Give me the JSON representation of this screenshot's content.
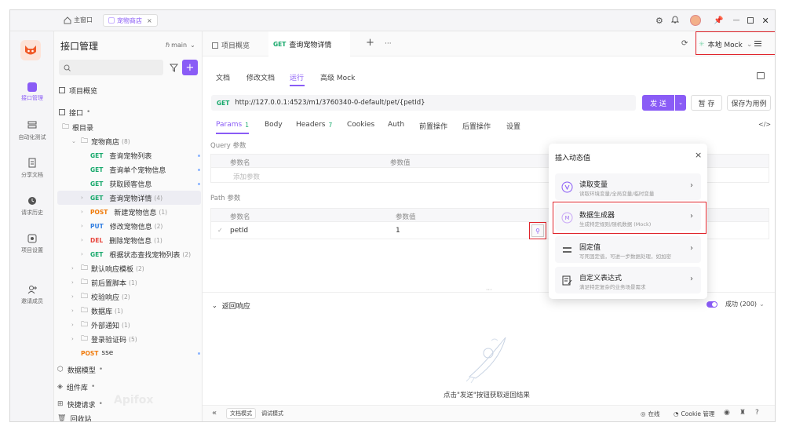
{
  "window": {
    "home_tab": "主窗口",
    "project_tab": "宠物商店"
  },
  "left_nav": [
    {
      "label": "接口管理",
      "icon": "api-management-icon"
    },
    {
      "label": "自动化测试",
      "icon": "automation-icon"
    },
    {
      "label": "分享文档",
      "icon": "share-docs-icon"
    },
    {
      "label": "请求历史",
      "icon": "history-icon"
    },
    {
      "label": "项目设置",
      "icon": "settings-icon"
    },
    {
      "label": "邀请成员",
      "icon": "invite-icon"
    }
  ],
  "tree": {
    "title": "接口管理",
    "branch": "main",
    "search_placeholder": "",
    "overview": "项目概览",
    "interfaces": "接口",
    "root": "根目录",
    "folder": "宠物商店",
    "folder_count": "(8)",
    "endpoints": [
      {
        "method": "GET",
        "name": "查询宠物列表",
        "count": ""
      },
      {
        "method": "GET",
        "name": "查询单个宠物信息",
        "count": ""
      },
      {
        "method": "GET",
        "name": "获取顾客信息",
        "count": ""
      },
      {
        "method": "GET",
        "name": "查询宠物详情",
        "count": "(4)"
      },
      {
        "method": "POST",
        "name": "新建宠物信息",
        "count": "(1)"
      },
      {
        "method": "PUT",
        "name": "修改宠物信息",
        "count": "(2)"
      },
      {
        "method": "DEL",
        "name": "删除宠物信息",
        "count": "(1)"
      },
      {
        "method": "GET",
        "name": "根据状态查找宠物列表",
        "count": "(2)"
      }
    ],
    "folders": [
      {
        "name": "默认响应模板",
        "count": "(2)"
      },
      {
        "name": "前后置脚本",
        "count": "(1)"
      },
      {
        "name": "校验响应",
        "count": "(2)"
      },
      {
        "name": "数据库",
        "count": "(1)"
      },
      {
        "name": "外部通知",
        "count": "(1)"
      },
      {
        "name": "登录验证码",
        "count": "(5)"
      }
    ],
    "sse": {
      "method": "POST",
      "name": "sse"
    },
    "bottom": [
      "数据模型",
      "组件库",
      "快捷请求",
      "回收站"
    ],
    "watermark": "Apifox"
  },
  "tabs": {
    "overview": "项目概览",
    "active_method": "GET",
    "active_name": "查询宠物详情",
    "add": "+",
    "more": "···"
  },
  "env": "本地 Mock",
  "subtabs": [
    "文档",
    "修改文档",
    "运行",
    "高级 Mock"
  ],
  "request": {
    "method": "GET",
    "url": "http://127.0.0.1:4523/m1/3760340-0-default/pet/{petId}",
    "send": "发 送",
    "save": "暂 存",
    "save_case": "保存为用例"
  },
  "param_tabs": [
    {
      "label": "Params",
      "count": "1"
    },
    {
      "label": "Body",
      "count": ""
    },
    {
      "label": "Headers",
      "count": "7"
    },
    {
      "label": "Cookies",
      "count": ""
    },
    {
      "label": "Auth",
      "count": ""
    },
    {
      "label": "前置操作",
      "count": ""
    },
    {
      "label": "后置操作",
      "count": ""
    },
    {
      "label": "设置",
      "count": ""
    }
  ],
  "query": {
    "title": "Query 参数",
    "col_name": "参数名",
    "col_value": "参数值",
    "add": "添加参数"
  },
  "path": {
    "title": "Path 参数",
    "col_name": "参数名",
    "col_value": "参数值",
    "name": "petId",
    "value": "1"
  },
  "popup": {
    "title": "插入动态值",
    "items": [
      {
        "title": "读取变量",
        "sub": "读取环境变量/全局变量/临时变量",
        "icon": "variable-icon"
      },
      {
        "title": "数据生成器",
        "sub": "生成特定规则/随机数据 (Mock)",
        "icon": "mock-icon"
      },
      {
        "title": "固定值",
        "sub": "写死固定值，可进一步数据处理，如加密",
        "icon": "equals-icon"
      },
      {
        "title": "自定义表达式",
        "sub": "满足特定复杂的业务场景需求",
        "icon": "expression-icon"
      }
    ]
  },
  "response": {
    "title": "返回响应",
    "status": "成功 (200)",
    "empty": "点击\"发送\"按钮获取返回结果"
  },
  "footer": {
    "doc_mode": "文档模式",
    "debug_mode": "调试模式",
    "online": "在线",
    "cookie": "Cookie 管理"
  },
  "colors": {
    "accent": "#8a5cf6",
    "get": "#17a86b",
    "post": "#f07b0b",
    "put": "#2f7de1",
    "del": "#e8453c",
    "highlight": "#e0242b"
  }
}
